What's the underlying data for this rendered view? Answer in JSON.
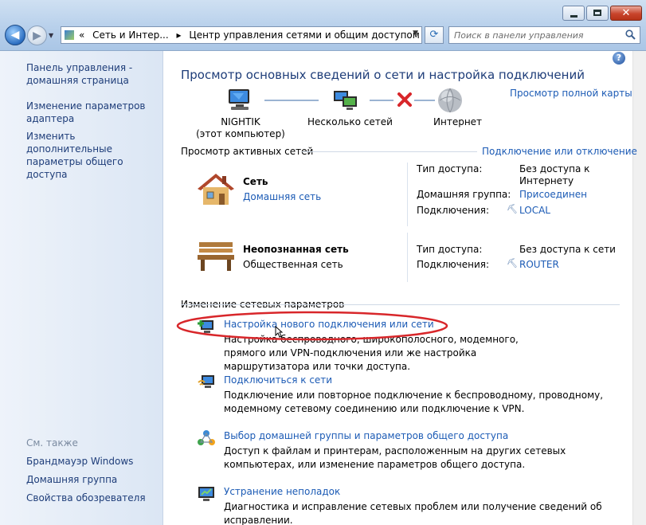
{
  "window": {
    "controls": {
      "close": "✕"
    },
    "address": {
      "path_prefix": "«",
      "segment1": "Сеть и Интер...",
      "arrow": "▸",
      "segment2": "Центр управления сетями и общим доступом"
    },
    "search": {
      "placeholder": "Поиск в панели управления"
    }
  },
  "sidebar": {
    "links": [
      "Панель управления - домашняя страница",
      "Изменение параметров адаптера",
      "Изменить дополнительные параметры общего доступа"
    ],
    "see_also": "См. также",
    "see_also_links": [
      "Брандмауэр Windows",
      "Домашняя группа",
      "Свойства обозревателя"
    ]
  },
  "main": {
    "title": "Просмотр основных сведений о сети и настройка подключений",
    "full_map": "Просмотр полной карты",
    "map": {
      "computer_name": "NIGHTIK",
      "computer_sub": "(этот компьютер)",
      "networks": "Несколько сетей",
      "internet": "Интернет"
    },
    "active_header": "Просмотр активных сетей",
    "connect_disconnect": "Подключение или отключение",
    "networks": [
      {
        "name": "Сеть",
        "type": "Домашняя сеть",
        "props": [
          {
            "label": "Тип доступа:",
            "value": "Без доступа к Интернету",
            "link": false
          },
          {
            "label": "Домашняя группа:",
            "value": "Присоединен",
            "link": true
          },
          {
            "label": "Подключения:",
            "value": "LOCAL",
            "link": true
          }
        ]
      },
      {
        "name": "Неопознанная сеть",
        "type": "Общественная сеть",
        "props": [
          {
            "label": "Тип доступа:",
            "value": "Без доступа к сети",
            "link": false
          },
          {
            "label": "Подключения:",
            "value": "ROUTER",
            "link": true
          }
        ]
      }
    ],
    "change_header": "Изменение сетевых параметров",
    "tasks": [
      {
        "title": "Настройка нового подключения или сети",
        "desc": "Настройка беспроводного, широкополосного, модемного, прямого или VPN-подключения или же настройка маршрутизатора или точки доступа."
      },
      {
        "title": "Подключиться к сети",
        "desc": "Подключение или повторное подключение к беспроводному, проводному, модемному сетевому соединению или подключение к VPN."
      },
      {
        "title": "Выбор домашней группы и параметров общего доступа",
        "desc": "Доступ к файлам и принтерам, расположенным на других сетевых компьютерах, или изменение параметров общего доступа."
      },
      {
        "title": "Устранение неполадок",
        "desc": "Диагностика и исправление сетевых проблем или получение сведений об исправлении."
      }
    ],
    "help_glyph": "?"
  },
  "colors": {
    "link": "#1c5bb5",
    "heading": "#1e3d79",
    "annotation": "#d8262a"
  }
}
